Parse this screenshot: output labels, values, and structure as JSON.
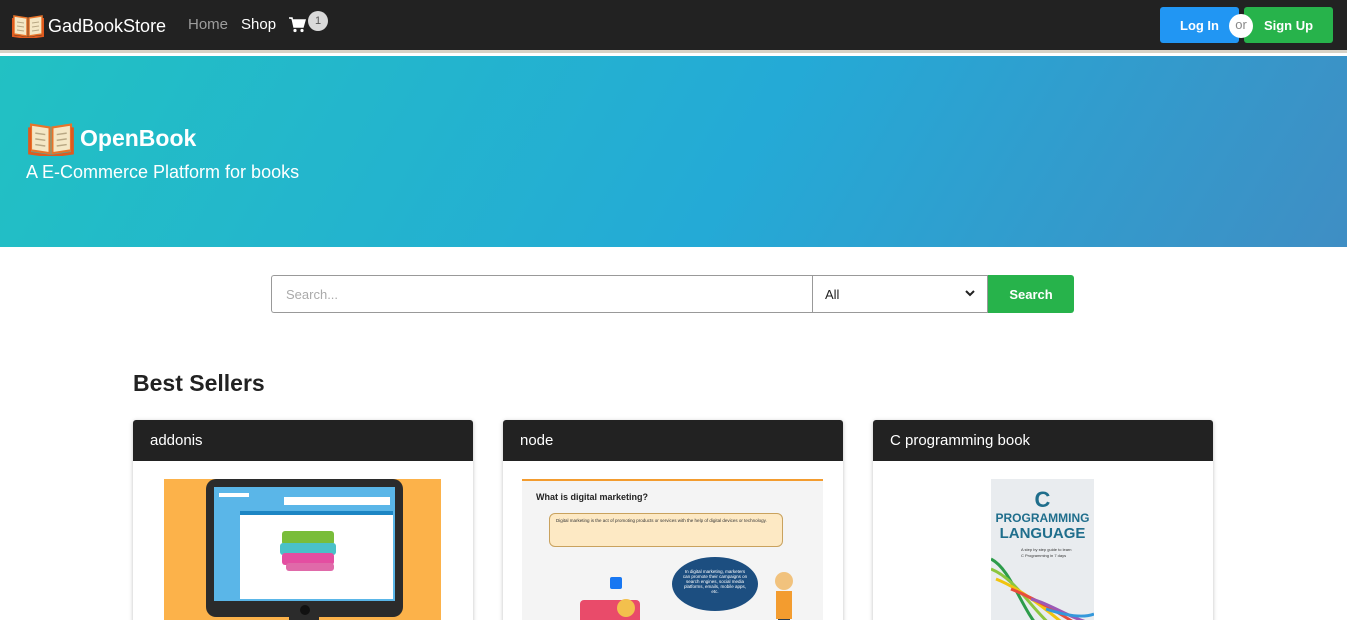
{
  "navbar": {
    "brand": "GadBookStore",
    "links": {
      "home": "Home",
      "shop": "Shop"
    },
    "cart_count": "1",
    "login_label": "Log In",
    "or_label": "or",
    "signup_label": "Sign Up"
  },
  "hero": {
    "title": "OpenBook",
    "subtitle": "A E-Commerce Platform for books"
  },
  "search": {
    "placeholder": "Search...",
    "category_selected": "All",
    "button_label": "Search"
  },
  "best_sellers": {
    "title": "Best Sellers",
    "books": [
      {
        "title": "addonis"
      },
      {
        "title": "node",
        "cover_heading": "What is digital marketing?",
        "cover_box": "Digital marketing is the act of promoting products or services with the help of digital devices or technology.",
        "cover_bubble": "In digital marketing, marketers can promote their campaigns on search engines, social media platforms, emails, mobile apps, etc."
      },
      {
        "title": "C programming book",
        "cover_big": "C",
        "cover_line1": "PROGRAMMING",
        "cover_line2": "LANGUAGE",
        "cover_tag1": "A step by step guide to learn",
        "cover_tag2": "C Programming in 7 days"
      }
    ]
  },
  "colors": {
    "navbar": "#222222",
    "login": "#2196f3",
    "signup": "#27b34b",
    "hero_start": "#22c1c3",
    "hero_end": "#3f8ec4"
  }
}
